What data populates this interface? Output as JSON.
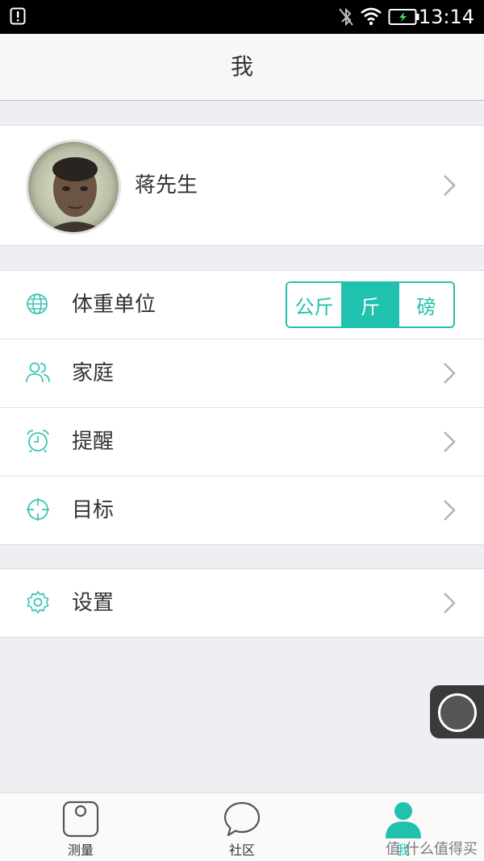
{
  "status_bar": {
    "time": "13:14",
    "icons": [
      "alert-icon",
      "bluetooth-off-icon",
      "wifi-icon",
      "battery-charging-icon"
    ]
  },
  "header": {
    "title": "我"
  },
  "profile": {
    "name": "蒋先生",
    "avatar": "user-avatar-photo"
  },
  "settings": {
    "weight_unit": {
      "label": "体重单位",
      "icon": "globe-icon",
      "options": [
        "公斤",
        "斤",
        "磅"
      ],
      "selected": "斤"
    },
    "items": [
      {
        "label": "家庭",
        "icon": "people-icon"
      },
      {
        "label": "提醒",
        "icon": "alarm-clock-icon"
      },
      {
        "label": "目标",
        "icon": "crosshair-target-icon"
      }
    ],
    "settings_item": {
      "label": "设置",
      "icon": "gear-icon"
    }
  },
  "tab_bar": {
    "tabs": [
      {
        "label": "测量",
        "icon": "scale-icon",
        "active": false
      },
      {
        "label": "社区",
        "icon": "chat-bubble-icon",
        "active": false
      },
      {
        "label": "我",
        "icon": "person-icon",
        "active": true
      }
    ]
  },
  "watermark": "值 什么值得买",
  "colors": {
    "accent": "#20c1ad",
    "background": "#efeff3"
  }
}
